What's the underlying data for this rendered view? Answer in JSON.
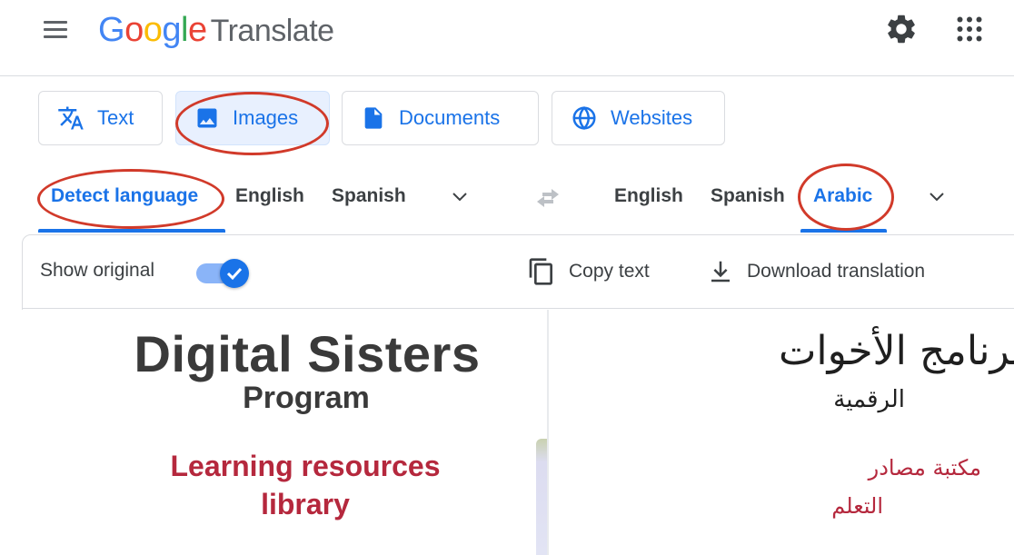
{
  "header": {
    "logo_letters": [
      "G",
      "o",
      "o",
      "g",
      "l",
      "e"
    ],
    "product_name": "Translate",
    "icons": {
      "menu": "hamburger-menu-icon",
      "settings": "gear-icon",
      "apps": "apps-grid-icon"
    }
  },
  "modes": [
    {
      "label": "Text",
      "icon": "translate-icon",
      "active": false
    },
    {
      "label": "Images",
      "icon": "image-icon",
      "active": true
    },
    {
      "label": "Documents",
      "icon": "document-icon",
      "active": false
    },
    {
      "label": "Websites",
      "icon": "globe-icon",
      "active": false
    }
  ],
  "source_languages": [
    "Detect language",
    "English",
    "Spanish"
  ],
  "source_selected": "Detect language",
  "target_languages": [
    "English",
    "Spanish",
    "Arabic"
  ],
  "target_selected": "Arabic",
  "toolbar": {
    "show_original_label": "Show original",
    "show_original_on": true,
    "copy_label": "Copy text",
    "download_label": "Download translation"
  },
  "source_image": {
    "title": "Digital Sisters",
    "subtitle": "Program",
    "library_line1": "Learning resources",
    "library_line2": "library"
  },
  "translated_image": {
    "title": "برنامج الأخوات",
    "subtitle": "الرقمية",
    "library_line1": "مكتبة مصادر",
    "library_line2": "التعلم"
  },
  "colors": {
    "accent": "#1a73e8",
    "annotation_oval": "#d13a2a",
    "library_text": "#b5283d"
  }
}
